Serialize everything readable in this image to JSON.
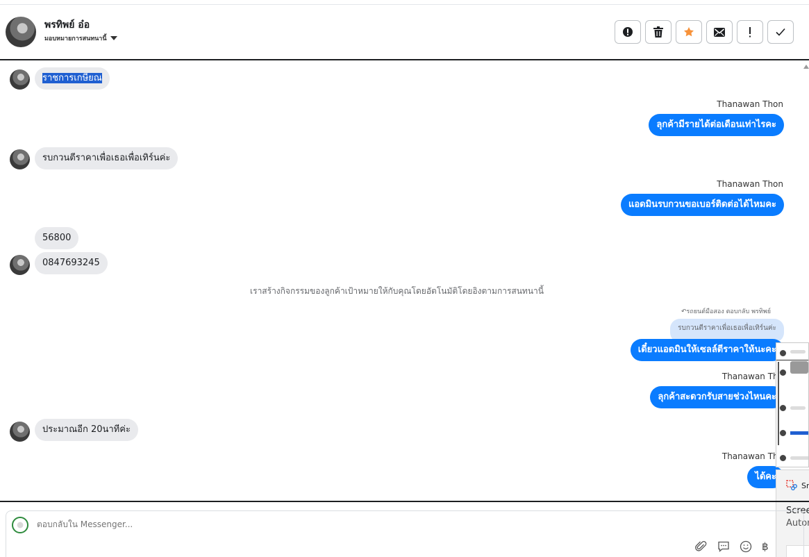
{
  "header": {
    "name": "พรทิพย์ อ๋อ",
    "assign_label": "มอบหมายการสนทนานี้",
    "actions": [
      {
        "name": "mark-spam-icon",
        "label": "spam"
      },
      {
        "name": "trash-icon",
        "label": "delete"
      },
      {
        "name": "star-icon",
        "label": "star"
      },
      {
        "name": "envelope-icon",
        "label": "unread"
      },
      {
        "name": "exclamation-icon",
        "label": "follow up"
      },
      {
        "name": "check-icon",
        "label": "done"
      }
    ],
    "star_color": "#f7923a"
  },
  "messages": {
    "m1": "ราชการเกษียณ",
    "s1": "Thanawan Thon",
    "m2": "ลุกค้ามีรายได้ต่อเดือนเท่าไรคะ",
    "m3": "รบกวนตีราคาเพื่อเธอเพื่อเทิร์นค่ะ",
    "s2": "Thanawan Thon",
    "m4": "แอดมินรบกวนขอเบอร์ติดต่อได้ไหมคะ",
    "m5": "56800",
    "m6": "0847693245",
    "system_note": "เราสร้างกิจกรรมของลูกค้าเป้าหมายให้กับคุณโดยอัตโนมัติโดยอิงตามการสนทนานี้",
    "reply_note": "↶รถยนต์มือสอง ตอบกลับ พรทิพย์",
    "quoted": "รบกวนตีราคาเพื่อเธอเพื่อเทิร์นค่ะ",
    "m7": "เดี๋ยวแอดมินให้เซลล์ตีราคาให้นะคะ",
    "s3": "Thanawan Tho",
    "m8": "ลุกค้าสะดวกรับสายช่วงไหนคะ",
    "m9": "ประมาณอีก 20นาทีค่ะ",
    "s4": "Thanawan Tho",
    "m10": "ได้คะ"
  },
  "notification": {
    "app": "Sn",
    "title": "Scree",
    "body": "Autor"
  },
  "composer": {
    "placeholder": "ตอบกลับใน Messenger...",
    "tools": [
      "paperclip-icon",
      "saved-reply-icon",
      "emoji-icon",
      "baht-icon"
    ],
    "baht_symbol": "฿"
  },
  "colors": {
    "outgoing": "#0a7cff",
    "incoming": "#e9eaed",
    "selection": "#1f5fd1"
  }
}
